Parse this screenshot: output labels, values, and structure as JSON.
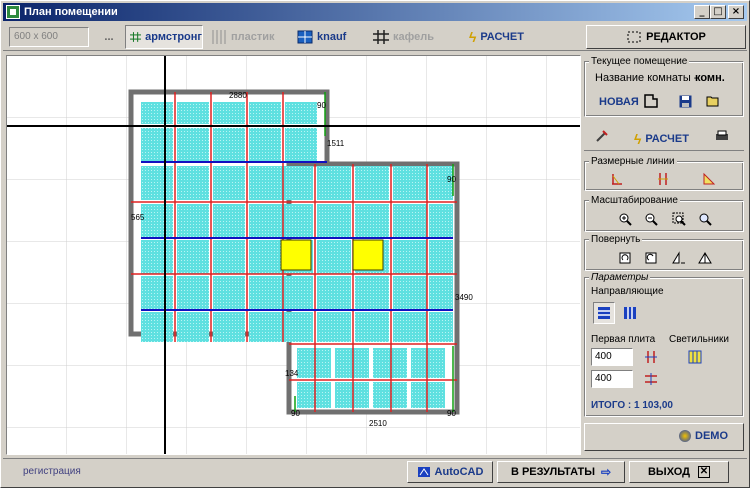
{
  "window": {
    "title": "План помещении",
    "min": "_",
    "max": "□",
    "close": "×"
  },
  "toolbar": {
    "tile_size": "600 x 600",
    "more": "...",
    "armstrong": "армстронг",
    "plastic": "пластик",
    "knauf": "knauf",
    "tile": "кафель",
    "calc": "РАСЧЕТ",
    "editor": "РЕДАКТОР"
  },
  "right": {
    "current_room_group": "Текущее помещение",
    "room_name_label": "Название комнаты -",
    "room_name_value": "комн.",
    "new_label": "НОВАЯ",
    "calc_label": "РАСЧЕТ",
    "dim_lines_group": "Размерные линии",
    "scale_group": "Масштабирование",
    "rotate_group": "Повернуть",
    "params_group": "Параметры",
    "guides_label": "Направляющие",
    "first_tile_label": "Первая плита",
    "lights_label": "Светильники",
    "first_tile_x": "400",
    "first_tile_y": "400",
    "total_label": "ИТОГО :",
    "total_value": "1 103,00",
    "demo": "DEMO"
  },
  "plan": {
    "dim_top": "2880",
    "dim_90_a": "90",
    "dim_1511": "1511",
    "dim_90_b": "90",
    "dim_3490": "3490",
    "dim_565": "565",
    "dim_134": "134",
    "dim_90_c": "90",
    "dim_90_d": "90",
    "dim_2510": "2510"
  },
  "status": {
    "registration": "регистрация",
    "autocad": "AutoCAD",
    "to_results": "В РЕЗУЛЬТАТЫ",
    "exit": "ВЫХОД"
  },
  "colors": {
    "tile": "#5fe0e0",
    "red_line": "#e02020",
    "blue_line": "#1010c0",
    "green_line": "#10a010",
    "light": "#ffff00",
    "wall": "#707070"
  }
}
